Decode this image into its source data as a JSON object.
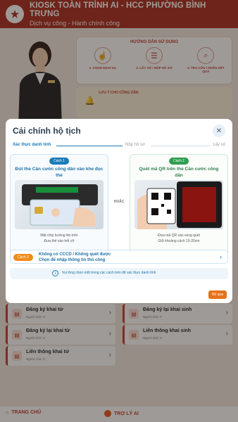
{
  "header": {
    "title": "KIOSK TOÀN TRÌNH AI - HCC PHƯỜNG BÌNH TRƯNG",
    "subtitle": "Dịch vụ công - Hành chính công"
  },
  "guide": {
    "title": "HƯỚNG DẪN SỬ DỤNG",
    "steps": [
      "1. CHỌN DỊCH VỤ",
      "2. LẤY SỐ / NỘP HỒ SƠ",
      "3. TRA CỨU / NHẬN KẾT QUẢ"
    ]
  },
  "note": {
    "title": "LƯU Ý CHO CÔNG DÂN"
  },
  "modal": {
    "title": "Cải chính hộ tịch",
    "steps": [
      "Xác thực danh tính",
      "Nộp hồ sơ",
      "Lấy số"
    ],
    "option1": {
      "badge": "Cách 1",
      "title": "Đút thẻ Căn cước công dân vào khe đọc thẻ",
      "caption1": "Mặt chip hướng lên trên",
      "caption2": "Đưa thẻ vào hết cỡ"
    },
    "or_label": "HOẶC",
    "option2": {
      "badge": "Cách 2",
      "title": "Quét mã QR trên thẻ Căn cước công dân",
      "caption1": "Đưa mã QR vào vùng quét",
      "caption2": "Giữ khoảng cách 10-20cm"
    },
    "option3": {
      "badge": "Cách 3",
      "line1": "Không có CCCD / Không quét được",
      "line2": "Chọn để nhập thông tin thủ công"
    },
    "info": "Vui lòng chọn một trong các cách trên để xác thực danh tính",
    "skip": "Bỏ qua"
  },
  "tiles": [
    {
      "title": "Đăng ký khai tử",
      "sub": "Người chờ: 0"
    },
    {
      "title": "Đăng ký lại khai sinh",
      "sub": "Người chờ: 0"
    },
    {
      "title": "Đăng ký lại khai tử",
      "sub": "Người chờ: 0"
    },
    {
      "title": "Liên thông khai sinh",
      "sub": "Người chờ: 0"
    },
    {
      "title": "Liên thông khai tử",
      "sub": "Người chờ: 0"
    }
  ],
  "footer": {
    "home": "TRANG CHỦ",
    "ai": "TRỢ LÝ AI"
  }
}
